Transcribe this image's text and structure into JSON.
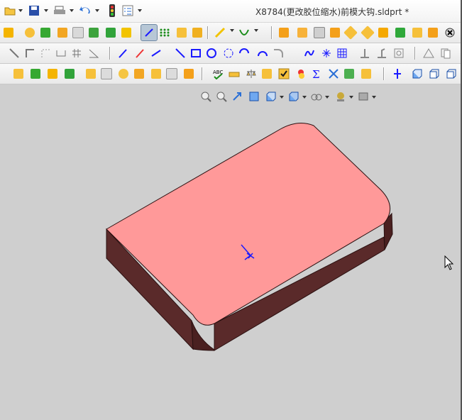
{
  "window": {
    "title": "X8784(更改胶位缩水)前模大钩.sldprt *"
  },
  "toolbars": {
    "quick_access": [
      "new-icon",
      "open-icon",
      "save-icon",
      "print-icon",
      "undo-icon",
      "rebuild-icon",
      "options-icon"
    ],
    "features": [
      "extrude-icon",
      "revolve-icon",
      "sweep-icon",
      "loft-icon",
      "fillet-icon",
      "pattern-icon",
      "rib-icon",
      "sketch-icon",
      "grid-icon",
      "smart-dimension-icon",
      "curve-icon",
      "mold-tool-icon"
    ],
    "sketch": [
      "line-icon",
      "rectangle-icon",
      "circle-icon",
      "arc-icon",
      "spline-icon",
      "point-icon",
      "trim-icon",
      "mirror-icon"
    ],
    "tools": [
      "spelling-icon",
      "measure-icon",
      "mass-properties-icon",
      "check-icon",
      "sum-icon",
      "statistics-icon",
      "reference-axis-icon",
      "view-cube-icon"
    ],
    "view": [
      "zoom-to-fit-icon",
      "zoom-area-icon",
      "rotate-icon",
      "section-view-icon",
      "view-orientation-icon",
      "display-style-icon",
      "hide-show-icon",
      "appearance-icon",
      "scene-icon"
    ]
  },
  "colors": {
    "part_top": "#ff9999",
    "part_side": "#5a2a2a",
    "triad_blue": "#1a1aff",
    "viewport_bg": "#cfcfcf"
  }
}
